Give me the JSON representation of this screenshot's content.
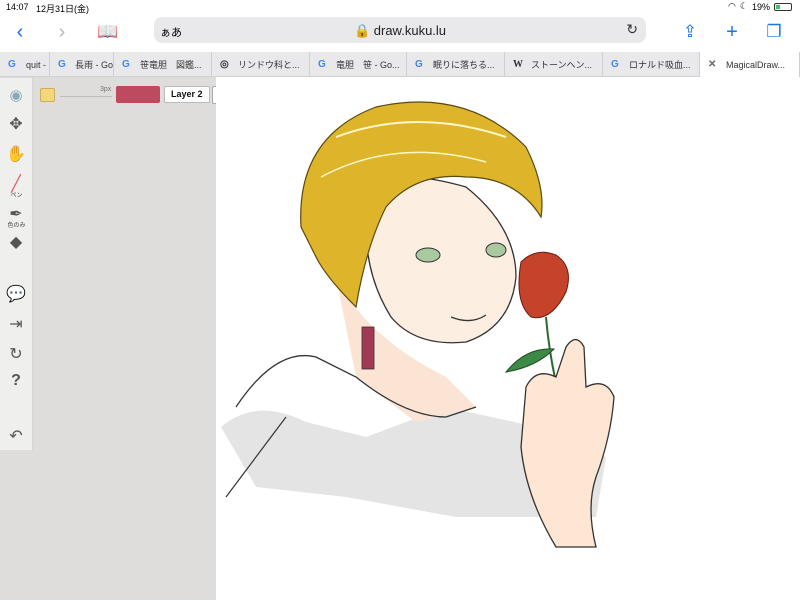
{
  "status": {
    "time": "14:07",
    "date": "12月31日(金)",
    "battery_percent": "19%"
  },
  "browser": {
    "aa_label": "ぁあ",
    "url": "draw.kuku.lu",
    "tabs": [
      {
        "icon": "G",
        "label": "quit -"
      },
      {
        "icon": "G",
        "label": "長雨 - Go"
      },
      {
        "icon": "G",
        "label": "笹竜胆　図鑑..."
      },
      {
        "icon": "◎",
        "label": "リンドウ科と..."
      },
      {
        "icon": "G",
        "label": "竜胆　笹 - Go..."
      },
      {
        "icon": "G",
        "label": "眠りに落ちる..."
      },
      {
        "icon": "W",
        "label": "ストーンヘン..."
      },
      {
        "icon": "G",
        "label": "ロナルド吸血..."
      },
      {
        "icon": "✕",
        "label": "MagicalDraw..."
      }
    ]
  },
  "drawing_app": {
    "tools": {
      "pen_label": "ペン",
      "eyedropper_label": "色のみ"
    },
    "brush_size": "3px",
    "layer_label": "Layer 2",
    "colors": {
      "current_small": "#f5d67a",
      "current_main": "#bd4a5e"
    }
  }
}
